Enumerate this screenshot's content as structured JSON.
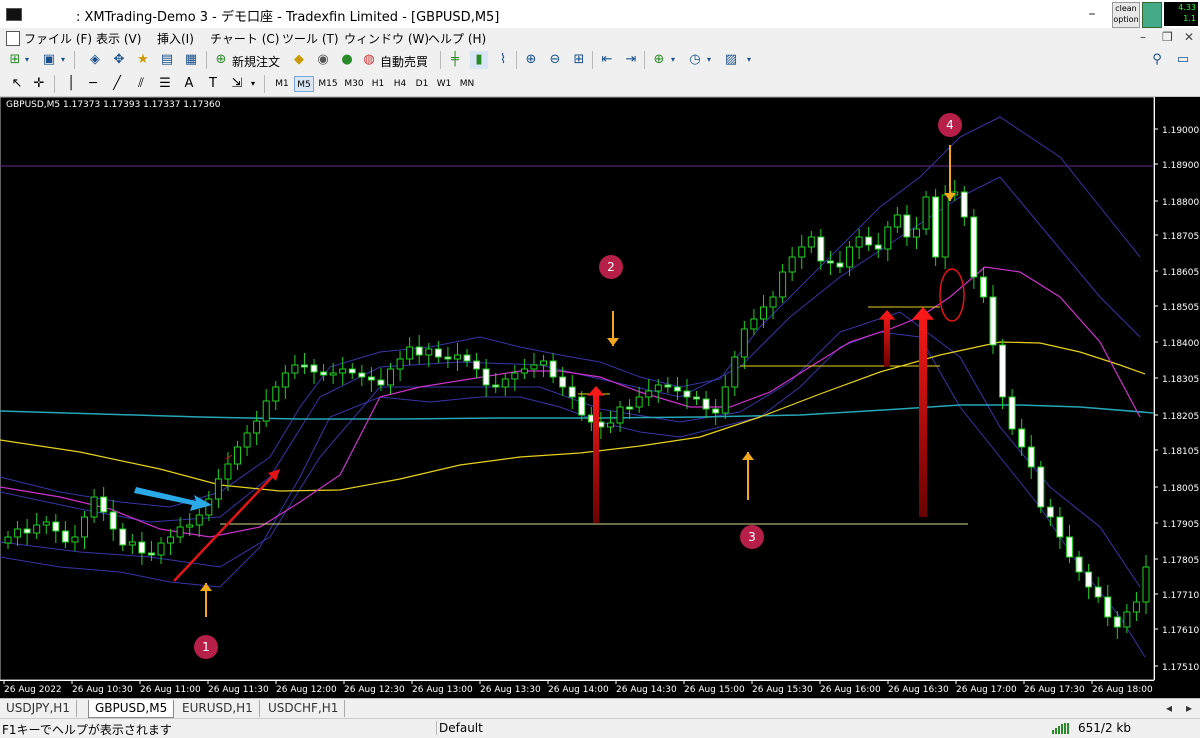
{
  "window": {
    "title": ": XMTrading-Demo 3 - デモ口座 - Tradexfin Limited - [GBPUSD,M5]",
    "badge_label": "clean option",
    "badge_numbers": "4.33 1.1"
  },
  "menu": {
    "items": [
      "ファイル (F)",
      "表示 (V)",
      "挿入(I)",
      "チャート (C)",
      "ツール (T)",
      "ウィンドウ (W)",
      "ヘルプ (H)"
    ]
  },
  "toolbar": {
    "new_order_label": "新規注文",
    "autotrading_label": "自動売買",
    "timeframes": [
      "M1",
      "M5",
      "M15",
      "M30",
      "H1",
      "H4",
      "D1",
      "W1",
      "MN"
    ],
    "active_timeframe": "M5"
  },
  "chart": {
    "symbol_label": "GBPUSD,M5  1.17373 1.17393 1.17337 1.17360",
    "price_axis": [
      "1.19000",
      "1.18900",
      "1.18800",
      "1.18705",
      "1.18605",
      "1.18505",
      "1.18400",
      "1.18305",
      "1.18205",
      "1.18105",
      "1.18005",
      "1.17905",
      "1.17805",
      "1.17710",
      "1.17610",
      "1.17510"
    ],
    "time_axis": [
      "26 Aug 2022",
      "26 Aug 10:30",
      "26 Aug 11:00",
      "26 Aug 11:30",
      "26 Aug 12:00",
      "26 Aug 12:30",
      "26 Aug 13:00",
      "26 Aug 13:30",
      "26 Aug 14:00",
      "26 Aug 14:30",
      "26 Aug 15:00",
      "26 Aug 15:30",
      "26 Aug 16:00",
      "26 Aug 16:30",
      "26 Aug 17:00",
      "26 Aug 17:30",
      "26 Aug 18:00"
    ],
    "markers": [
      "1",
      "2",
      "3",
      "4"
    ],
    "colors": {
      "background": "#000000",
      "bull_candle": "#000000",
      "bear_candle": "#ffffff",
      "wick": "#1fd01f",
      "ma_short": "#cc33cc",
      "ma_mid": "#e8d020",
      "ma_long": "#27a6b8",
      "bands": "#3636a8",
      "annotation_orange": "#f3a81c",
      "annotation_red": "#e11515",
      "annotation_blue": "#2aa8e8",
      "marker_circle": "#b51f48"
    }
  },
  "tabs": [
    "USDJPY,H1",
    "GBPUSD,M5",
    "EURUSD,H1",
    "USDCHF,H1"
  ],
  "active_tab": "GBPUSD,M5",
  "status": {
    "help": "F1キーでヘルプが表示されます",
    "profile": "Default",
    "connection": "651/2 kb"
  }
}
